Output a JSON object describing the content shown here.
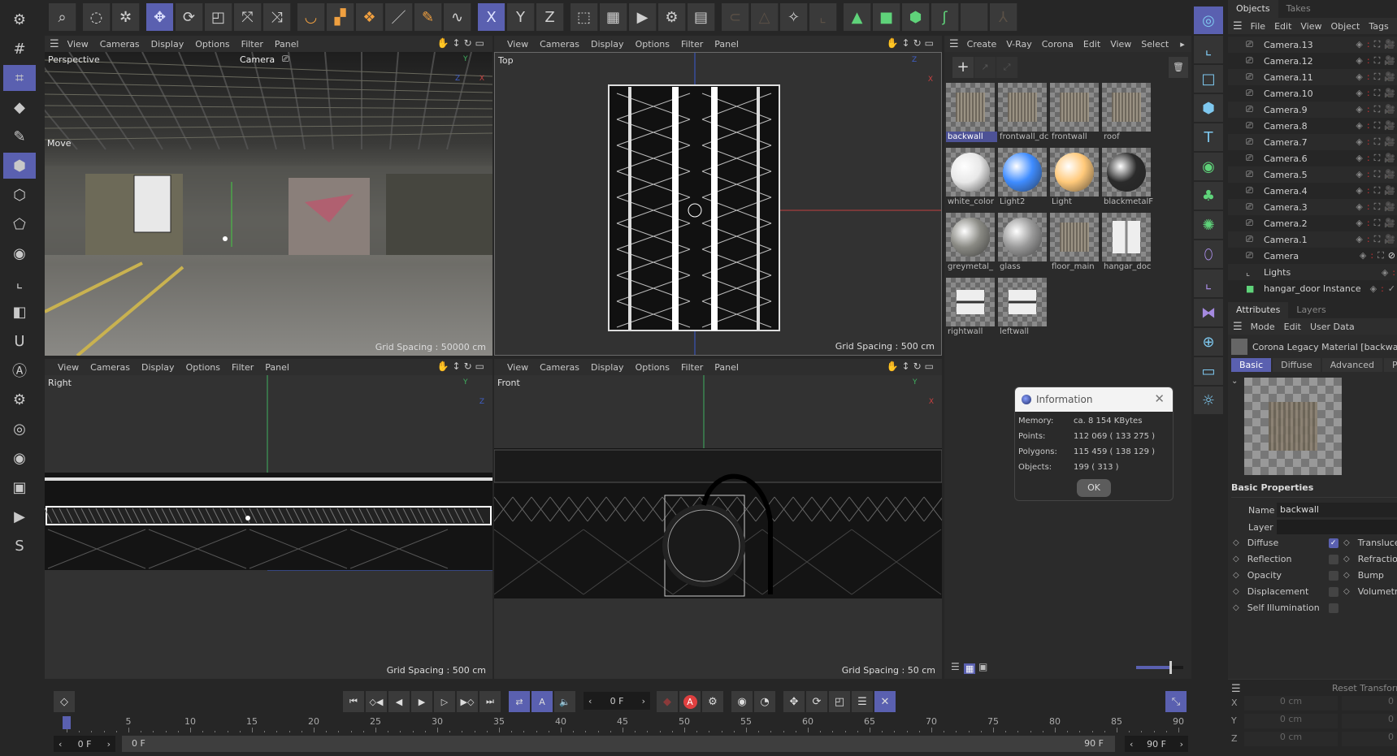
{
  "top_toolbar": {
    "tools": [
      {
        "icon": "search-icon",
        "glyph": "⌕"
      },
      {
        "icon": "live-selection-icon",
        "glyph": "◌"
      },
      {
        "icon": "selection-settings-icon",
        "glyph": "✲"
      },
      {
        "icon": "move-icon",
        "glyph": "✥",
        "active": true
      },
      {
        "icon": "rotate-icon",
        "glyph": "⟳"
      },
      {
        "icon": "scale-icon",
        "glyph": "◰"
      },
      {
        "icon": "transform-icon",
        "glyph": "⤧"
      },
      {
        "icon": "multi-transform-icon",
        "glyph": "⤨"
      },
      {
        "icon": "soft-selection-icon",
        "glyph": "◡"
      },
      {
        "icon": "paint-point-icon",
        "glyph": "▞"
      },
      {
        "icon": "paint-multi-icon",
        "glyph": "❖"
      },
      {
        "icon": "brush-icon",
        "glyph": "／"
      },
      {
        "icon": "pen-icon",
        "glyph": "✎"
      },
      {
        "icon": "spline-icon",
        "glyph": "∿"
      },
      {
        "icon": "x-axis-lock-icon",
        "glyph": "X",
        "active": true
      },
      {
        "icon": "y-axis-icon",
        "glyph": "Y"
      },
      {
        "icon": "z-axis-icon",
        "glyph": "Z"
      },
      {
        "icon": "coordinate-system-icon",
        "glyph": "⬚"
      },
      {
        "icon": "render-view-icon",
        "glyph": "▦"
      },
      {
        "icon": "render-picture-viewer-icon",
        "glyph": "▶"
      },
      {
        "icon": "render-settings-icon",
        "glyph": "⚙"
      },
      {
        "icon": "render-queue-icon",
        "glyph": "▤"
      },
      {
        "icon": "link-icon",
        "glyph": "⊂",
        "dim": true
      },
      {
        "icon": "polygon-pen-icon",
        "glyph": "△",
        "dim": true
      },
      {
        "icon": "snap-icon",
        "glyph": "✧"
      },
      {
        "icon": "workplane-icon",
        "glyph": "⌞",
        "dim": true
      },
      {
        "icon": "corona-light-icon",
        "glyph": "▲"
      },
      {
        "icon": "corona-proxy-icon",
        "glyph": "■"
      },
      {
        "icon": "corona-box-icon",
        "glyph": "⬢"
      },
      {
        "icon": "corona-spline-icon",
        "glyph": "ʃ"
      },
      {
        "icon": "empty-slot-icon",
        "glyph": ""
      },
      {
        "icon": "character-icon",
        "glyph": "⅄",
        "dim": true
      }
    ]
  },
  "left_toolbar": {
    "tools": [
      {
        "icon": "object-mode-icon",
        "glyph": "⚙"
      },
      {
        "icon": "grid-icon",
        "glyph": "#"
      },
      {
        "icon": "workplane-grid-icon",
        "glyph": "⌗",
        "active": true
      },
      {
        "icon": "points-mode-icon",
        "glyph": "◆"
      },
      {
        "icon": "edge-mode-icon",
        "glyph": "✎"
      },
      {
        "icon": "polygon-mode-icon",
        "glyph": "⬢",
        "active": true
      },
      {
        "icon": "uv-mode-icon",
        "glyph": "⬡"
      },
      {
        "icon": "model-mode-icon",
        "glyph": "⬠"
      },
      {
        "icon": "axis-mode-icon",
        "glyph": "◉"
      },
      {
        "icon": "workplane-axis-icon",
        "glyph": "⌞"
      },
      {
        "icon": "texture-mode-icon",
        "glyph": "◧"
      },
      {
        "icon": "magnet-icon",
        "glyph": "U"
      },
      {
        "icon": "auto-key-icon",
        "glyph": "Ⓐ"
      },
      {
        "icon": "settings-icon",
        "glyph": "⚙"
      },
      {
        "icon": "solo-icon",
        "glyph": "◎"
      },
      {
        "icon": "visibility-icon",
        "glyph": "◉"
      },
      {
        "icon": "render-region-icon",
        "glyph": "▣"
      },
      {
        "icon": "render-active-view-icon",
        "glyph": "▶"
      },
      {
        "icon": "corona-s-icon",
        "glyph": "S"
      }
    ]
  },
  "viewports": [
    {
      "label": "Perspective",
      "camera_label": "Camera",
      "tool_label": "Move",
      "grid": "Grid Spacing : 50000 cm",
      "axes": [
        "Y",
        "X",
        "Z"
      ]
    },
    {
      "label": "Top",
      "grid": "Grid Spacing : 500 cm",
      "axes": [
        "Z",
        "X"
      ]
    },
    {
      "label": "Right",
      "grid": "Grid Spacing : 500 cm",
      "axes": [
        "Y",
        "Z"
      ]
    },
    {
      "label": "Front",
      "grid": "Grid Spacing : 50 cm",
      "axes": [
        "Y",
        "X"
      ]
    }
  ],
  "viewport_menu": [
    "View",
    "Cameras",
    "Display",
    "Options",
    "Filter",
    "Panel"
  ],
  "material_manager": {
    "menu": [
      "Create",
      "V-Ray",
      "Corona",
      "Edit",
      "View",
      "Select"
    ],
    "materials": [
      {
        "name": "backwall",
        "kind": "wall",
        "selected": true
      },
      {
        "name": "frontwall_door",
        "display": "frontwall_dc",
        "kind": "wall"
      },
      {
        "name": "frontwall",
        "kind": "wall"
      },
      {
        "name": "roof",
        "kind": "wall"
      },
      {
        "name": "white_color",
        "kind": "sphere",
        "color": "#e8e8e8"
      },
      {
        "name": "Light2",
        "kind": "sphere",
        "color": "#3f8cff"
      },
      {
        "name": "Light",
        "kind": "sphere",
        "color": "#ffc97a"
      },
      {
        "name": "blackmetalF",
        "kind": "sphere",
        "color": "#2a2a2a"
      },
      {
        "name": "greymetal_p",
        "display": "greymetal_",
        "kind": "sphere",
        "color": "#8a8a84"
      },
      {
        "name": "glass",
        "kind": "sphere",
        "color": "#9a9a9a"
      },
      {
        "name": "floor_main",
        "kind": "wall"
      },
      {
        "name": "hangar_door",
        "display": "hangar_doc",
        "kind": "door"
      },
      {
        "name": "rightwall",
        "kind": "panel"
      },
      {
        "name": "leftwall",
        "kind": "panel"
      }
    ]
  },
  "info_dialog": {
    "title": "Information",
    "rows": [
      {
        "label": "Memory:",
        "value": "ca. 8 154 KBytes"
      },
      {
        "label": "Points:",
        "value": "112 069 ( 133 275 )"
      },
      {
        "label": "Polygons:",
        "value": "115 459 ( 138 129 )"
      },
      {
        "label": "Objects:",
        "value": "199 ( 313 )"
      }
    ],
    "ok_label": "OK"
  },
  "right_palette": {
    "tools": [
      {
        "icon": "camera-orbit-icon",
        "glyph": "◎",
        "active": true
      },
      {
        "icon": "null-object-icon",
        "glyph": "⌞"
      },
      {
        "icon": "spline-rectangle-icon",
        "glyph": "□"
      },
      {
        "icon": "cube-icon",
        "glyph": "⬢"
      },
      {
        "icon": "text-icon",
        "glyph": "T"
      },
      {
        "icon": "generator-icon",
        "glyph": "◉"
      },
      {
        "icon": "cloner-icon",
        "glyph": "♣"
      },
      {
        "icon": "deformer-icon",
        "glyph": "✺"
      },
      {
        "icon": "field-icon",
        "glyph": "⬯"
      },
      {
        "icon": "scene-icon",
        "glyph": "⌞"
      },
      {
        "icon": "xpresso-icon",
        "glyph": "⧓"
      },
      {
        "icon": "environment-icon",
        "glyph": "⊕"
      },
      {
        "icon": "camera-icon",
        "glyph": "▭"
      },
      {
        "icon": "light-icon",
        "glyph": "☼"
      }
    ]
  },
  "objects_panel": {
    "tabs": [
      "Objects",
      "Takes"
    ],
    "menu": [
      "File",
      "Edit",
      "View",
      "Object",
      "Tags"
    ],
    "items": [
      {
        "name": "Camera.13",
        "type": "camera"
      },
      {
        "name": "Camera.12",
        "type": "camera"
      },
      {
        "name": "Camera.11",
        "type": "camera"
      },
      {
        "name": "Camera.10",
        "type": "camera"
      },
      {
        "name": "Camera.9",
        "type": "camera"
      },
      {
        "name": "Camera.8",
        "type": "camera"
      },
      {
        "name": "Camera.7",
        "type": "camera"
      },
      {
        "name": "Camera.6",
        "type": "camera"
      },
      {
        "name": "Camera.5",
        "type": "camera"
      },
      {
        "name": "Camera.4",
        "type": "camera"
      },
      {
        "name": "Camera.3",
        "type": "camera"
      },
      {
        "name": "Camera.2",
        "type": "camera"
      },
      {
        "name": "Camera.1",
        "type": "camera"
      },
      {
        "name": "Camera",
        "type": "camera-active"
      },
      {
        "name": "Lights",
        "type": "null"
      },
      {
        "name": "hangar_door Instance",
        "type": "instance"
      }
    ]
  },
  "attributes_panel": {
    "tabs": [
      "Attributes",
      "Layers"
    ],
    "menu": [
      "Mode",
      "Edit",
      "User Data"
    ],
    "title": "Corona Legacy Material [backwall]",
    "subtabs": [
      "Basic",
      "Diffuse",
      "Advanced",
      "Preview"
    ],
    "section": "Basic Properties",
    "name_label": "Name",
    "name_value": "backwall",
    "layer_label": "Layer",
    "layer_value": "",
    "channels_left": [
      {
        "label": "Diffuse",
        "checked": true
      },
      {
        "label": "Reflection",
        "checked": false
      },
      {
        "label": "Opacity",
        "checked": false
      },
      {
        "label": "Displacement",
        "checked": false
      },
      {
        "label": "Self Illumination",
        "checked": false
      }
    ],
    "channels_right": [
      "Translucency",
      "Refraction",
      "Bump",
      "Volumetrics"
    ]
  },
  "coordinates_panel": {
    "reset_label": "Reset Transform",
    "rows": [
      {
        "axis": "X",
        "value": "0 cm",
        "value2": "0"
      },
      {
        "axis": "Y",
        "value": "0 cm",
        "value2": "0"
      },
      {
        "axis": "Z",
        "value": "0 cm",
        "value2": "0"
      }
    ]
  },
  "timeline": {
    "current_frame": "0 F",
    "start_frame": "0 F",
    "range_start": "0 F",
    "range_end": "90 F",
    "end_frame": "90 F",
    "ticks": [
      "0",
      "5",
      "10",
      "15",
      "20",
      "25",
      "30",
      "35",
      "40",
      "45",
      "50",
      "55",
      "60",
      "65",
      "70",
      "75",
      "80",
      "85",
      "90"
    ],
    "min_frame": 0,
    "max_frame": 90,
    "playhead": 0,
    "controls": [
      {
        "icon": "go-to-start-icon",
        "glyph": "⏮"
      },
      {
        "icon": "previous-key-icon",
        "glyph": "◇◀"
      },
      {
        "icon": "previous-frame-icon",
        "glyph": "◀"
      },
      {
        "icon": "play-icon",
        "glyph": "▶"
      },
      {
        "icon": "next-frame-icon",
        "glyph": "▷"
      },
      {
        "icon": "next-key-icon",
        "glyph": "▶◇"
      },
      {
        "icon": "go-to-end-icon",
        "glyph": "⏭"
      },
      {
        "icon": "loop-icon",
        "glyph": "⇄",
        "active": true
      },
      {
        "icon": "playback-mode-icon",
        "glyph": "A",
        "active": true
      },
      {
        "icon": "sound-icon",
        "glyph": "🔈"
      }
    ],
    "record_controls": [
      {
        "icon": "record-icon",
        "glyph": "◆"
      },
      {
        "icon": "autokey-icon",
        "glyph": "A"
      },
      {
        "icon": "key-settings-icon",
        "glyph": "⚙"
      },
      {
        "icon": "keyframe-selection-icon",
        "glyph": "◉"
      },
      {
        "icon": "motion-system-icon",
        "glyph": "◔"
      },
      {
        "icon": "key-position-icon",
        "glyph": "✥"
      },
      {
        "icon": "key-rotation-icon",
        "glyph": "⟳"
      },
      {
        "icon": "key-scale-icon",
        "glyph": "◰"
      },
      {
        "icon": "key-parameter-icon",
        "glyph": "☰"
      },
      {
        "icon": "key-pla-icon",
        "glyph": "✕",
        "active": true
      }
    ]
  },
  "colors": {
    "accent": "#5a60b0",
    "bg": "#262626",
    "panel": "#2e2e2e",
    "axis_x": "#c84040",
    "axis_y": "#40b060",
    "axis_z": "#4060c8"
  }
}
